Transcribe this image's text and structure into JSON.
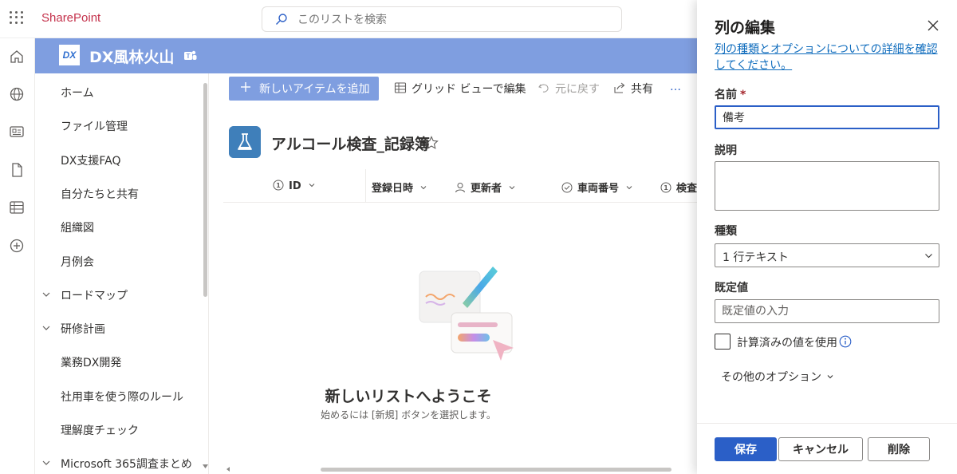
{
  "suite": {
    "brand": "SharePoint",
    "search_placeholder": "このリストを検索"
  },
  "rail": {
    "icons": [
      "home-icon",
      "globe-icon",
      "news-icon",
      "file-icon",
      "list-icon",
      "add-icon"
    ]
  },
  "site": {
    "logo_text": "DX",
    "title": "DX風林火山"
  },
  "nav": {
    "items": [
      {
        "label": "ホーム",
        "expandable": false
      },
      {
        "label": "ファイル管理",
        "expandable": false
      },
      {
        "label": "DX支援FAQ",
        "expandable": false
      },
      {
        "label": "自分たちと共有",
        "expandable": false
      },
      {
        "label": "組織図",
        "expandable": false
      },
      {
        "label": "月例会",
        "expandable": false
      },
      {
        "label": "ロードマップ",
        "expandable": true
      },
      {
        "label": "研修計画",
        "expandable": true
      },
      {
        "label": "業務DX開発",
        "expandable": false
      },
      {
        "label": "社用車を使う際のルール",
        "expandable": false
      },
      {
        "label": "理解度チェック",
        "expandable": false
      },
      {
        "label": "Microsoft 365調査まとめ",
        "expandable": true
      }
    ]
  },
  "commandbar": {
    "new_item": "新しいアイテムを追加",
    "grid_view": "グリッド ビューで編集",
    "undo": "元に戻す",
    "share": "共有",
    "more": "…"
  },
  "list": {
    "title": "アルコール検査_記録簿",
    "columns": [
      {
        "label": "ID",
        "icon": "number-icon",
        "dropdown": true
      },
      {
        "label": "登録日時",
        "icon": "",
        "dropdown": true
      },
      {
        "label": "更新者",
        "icon": "person-icon",
        "dropdown": true
      },
      {
        "label": "車両番号",
        "icon": "check-circle-icon",
        "dropdown": true
      },
      {
        "label": "検査",
        "icon": "number-icon",
        "dropdown": false
      }
    ],
    "welcome_title": "新しいリストへようこそ",
    "welcome_sub": "始めるには [新規] ボタンを選択します。"
  },
  "panel": {
    "title": "列の編集",
    "link": "列の種類とオプションについての詳細を確認してください。",
    "name_label": "名前",
    "required_mark": "*",
    "name_value": "備考",
    "desc_label": "説明",
    "type_label": "種類",
    "type_value": "1 行テキスト",
    "default_label": "既定値",
    "default_placeholder": "既定値の入力",
    "calc_label": "計算済みの値を使用",
    "more_options": "その他のオプション",
    "save": "保存",
    "cancel": "キャンセル",
    "delete": "削除"
  },
  "colors": {
    "accent": "#7f9ee0",
    "primary": "#2b5fc7",
    "brand_red": "#c4314b",
    "link": "#0f6cbd"
  }
}
